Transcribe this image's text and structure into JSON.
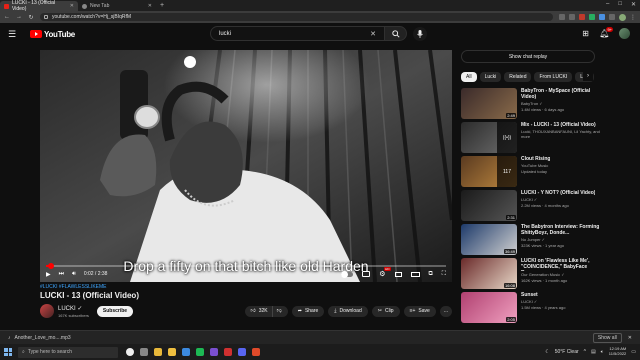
{
  "browser": {
    "tabs": [
      {
        "label": "LUCKI - 13 (Official Video)",
        "active": true
      },
      {
        "label": "New Tab",
        "active": false
      }
    ],
    "url": "youtube.com/watch?v=Hj_sjBIqRfM"
  },
  "masthead": {
    "logo_text": "YouTube",
    "search_query": "lucki",
    "notification_count": "9+"
  },
  "player": {
    "caption": "Drop a fifty on that bitch like old Harden",
    "time": "0:02 / 2:38",
    "progress_fraction": 0.013
  },
  "video": {
    "hashtags": "#LUCKI #FLAWLESSLIKEME",
    "title": "LUCKI - 13 (Official Video)",
    "channel": "LUCKI ✓",
    "subscribers": "167K subscribers",
    "subscribe_label": "Subscribe",
    "like_count": "32K",
    "share_label": "Share",
    "download_label": "Download",
    "clip_label": "Clip",
    "save_label": "Save",
    "more_label": "..."
  },
  "sidebar": {
    "chat_replay_label": "Show chat replay",
    "chips": [
      "All",
      "Lucki",
      "Related",
      "From LUCKI",
      "Live"
    ],
    "recommendations": [
      {
        "title": "BabyTron - MySpace (Official Video)",
        "sub1": "BabyTron ✓",
        "sub2": "1.4M views · 6 days ago",
        "duration": "2:49",
        "colors": [
          "#3a2a2a",
          "#8a6b4a"
        ]
      },
      {
        "title": "Mix - LUCKI - 13 (Official Video)",
        "sub1": "Lucki, THOUXANBANFAUNI, Lil Yachty, and more",
        "sub2": "",
        "duration": "",
        "mix": true,
        "colors": [
          "#2b2b2b",
          "#6f6f6f"
        ]
      },
      {
        "title": "Clout Rising",
        "sub1": "YouTube Music",
        "sub2": "Updated today",
        "duration": "",
        "playlist": "117",
        "colors": [
          "#5a3a20",
          "#c08a40"
        ]
      },
      {
        "title": "LUCKI - Y NOT? (Official Video)",
        "sub1": "LUCKI ✓",
        "sub2": "2.2M views · 4 months ago",
        "duration": "2:31",
        "colors": [
          "#1a1a1a",
          "#555555"
        ]
      },
      {
        "title": "The Babytron Interview: Forming ShittyBoyz, Donde...",
        "sub1": "No Jumper ✓",
        "sub2": "323K views · 1 year ago",
        "duration": "36:49",
        "colors": [
          "#1d3a6a",
          "#d0d0d0"
        ]
      },
      {
        "title": "LUCKI on 'Flawless Like Me', \"COINCIDENCE,\" BabyFace Ray...",
        "sub1": "Our Generation Music ✓",
        "sub2": "162K views · 1 month ago",
        "duration": "16:08",
        "colors": [
          "#6a2a2a",
          "#e8d8c8"
        ]
      },
      {
        "title": "Sunset",
        "sub1": "LUCKI ✓",
        "sub2": "1.5M views · 4 years ago",
        "duration": "2:05",
        "colors": [
          "#b04070",
          "#f0a0c0"
        ]
      }
    ]
  },
  "download_bar": {
    "file": "Another_Love_mo....mp3",
    "show_all": "Show all"
  },
  "taskbar": {
    "search_placeholder": "Type here to search",
    "weather": "50°F Clear",
    "time": "12:19 AM",
    "date": "11/5/2022"
  }
}
